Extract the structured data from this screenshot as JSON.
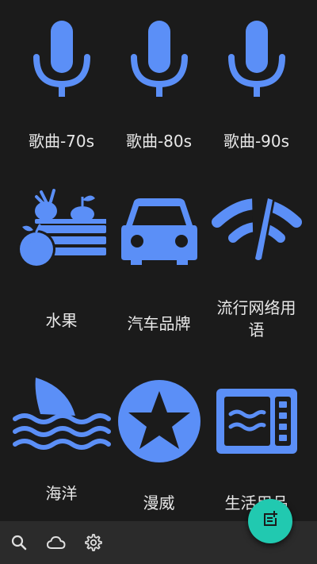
{
  "categories": [
    {
      "label": "歌曲-70s",
      "icon": "microphone-icon"
    },
    {
      "label": "歌曲-80s",
      "icon": "microphone-icon"
    },
    {
      "label": "歌曲-90s",
      "icon": "microphone-icon"
    },
    {
      "label": "水果",
      "icon": "fruit-basket-icon"
    },
    {
      "label": "汽车品牌",
      "icon": "car-icon"
    },
    {
      "label": "流行网络用语",
      "label_line2": "语",
      "label_line1": "流行网络用",
      "icon": "wifi-signal-icon"
    },
    {
      "label": "海洋",
      "icon": "shark-fin-waves-icon"
    },
    {
      "label": "漫威",
      "icon": "star-badge-icon"
    },
    {
      "label": "生活用品",
      "icon": "microwave-icon"
    }
  ],
  "bottom_bar": {
    "icons": [
      "search-icon",
      "cloud-icon",
      "settings-icon"
    ]
  },
  "fab": {
    "icon": "add-note-icon"
  },
  "colors": {
    "background": "#1b1b1b",
    "icon": "#5b8ff7",
    "fab": "#21c9b0",
    "bar": "#2b2b2b"
  }
}
